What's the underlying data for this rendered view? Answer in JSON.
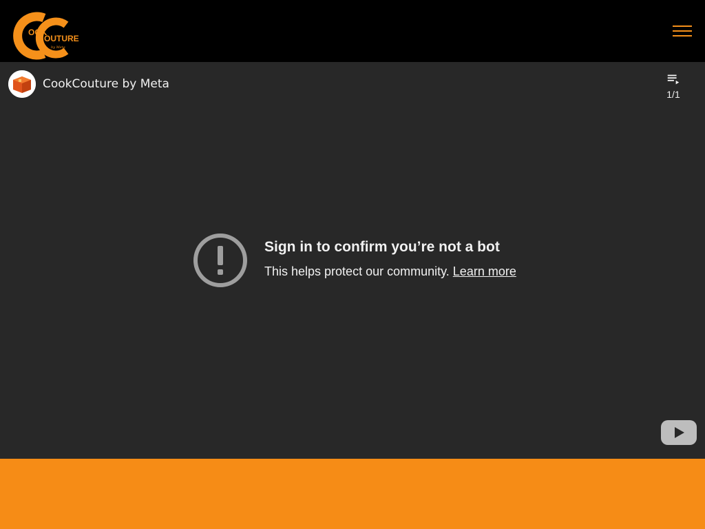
{
  "header": {
    "logo_text_top": "OOK",
    "logo_text_bottom": "OUTURE",
    "logo_script": "by Meta",
    "brand_color": "#f5901a",
    "menu_icon": "hamburger-menu-icon"
  },
  "embed": {
    "channel_name": "CookCouture by Meta",
    "playlist_icon": "playlist-icon",
    "playlist_count": "1/1",
    "error_icon": "exclamation-circle-icon",
    "error_title": "Sign in to confirm you’re not a bot",
    "error_message": "This helps protect our community.",
    "learn_more_label": "Learn more",
    "youtube_icon": "youtube-logo-icon",
    "background_color": "#282828"
  },
  "footer": {
    "band_color": "#f68c16"
  }
}
